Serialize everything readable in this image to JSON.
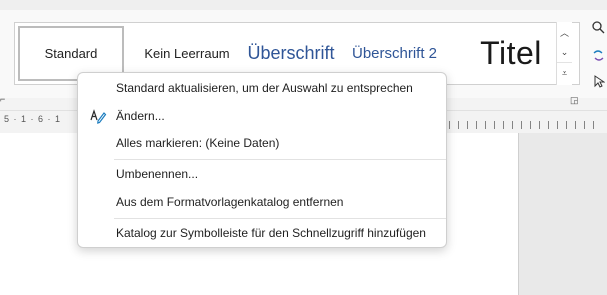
{
  "styles_gallery": {
    "items": [
      {
        "label": "Standard"
      },
      {
        "label": "Kein Leerraum"
      },
      {
        "label": "Überschrift"
      },
      {
        "label": "Überschrift 2"
      },
      {
        "label": "Titel"
      }
    ]
  },
  "ruler": {
    "text": "5 · 1 · 6 · 1"
  },
  "context_menu": {
    "items": [
      {
        "label": "Standard aktualisieren, um der Auswahl zu entsprechen"
      },
      {
        "label": "Ändern...",
        "icon": "edit-style-icon"
      },
      {
        "label": "Alles markieren: (Keine Daten)"
      },
      {
        "label": "Umbenennen..."
      },
      {
        "label": "Aus dem Formatvorlagenkatalog entfernen"
      },
      {
        "label": "Katalog zur Symbolleiste für den Schnellzugriff hinzufügen"
      }
    ]
  },
  "colors": {
    "heading_blue": "#2f5597",
    "accent": "#1c7dbf"
  }
}
